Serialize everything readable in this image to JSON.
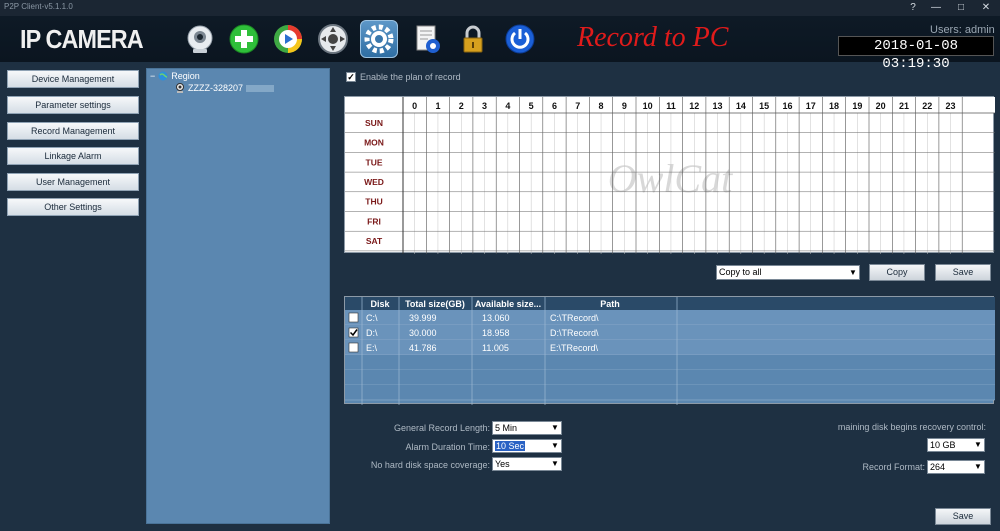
{
  "window": {
    "title": "P2P Client-v5.1.1.0",
    "help": "?",
    "minimize": "—",
    "maximize": "□",
    "close": "✕"
  },
  "header": {
    "app_title": "IP CAMERA",
    "toolbar": [
      {
        "name": "camera-icon"
      },
      {
        "name": "add-icon"
      },
      {
        "name": "playback-icon"
      },
      {
        "name": "ptz-icon"
      },
      {
        "name": "settings-icon",
        "active": true
      },
      {
        "name": "log-icon"
      },
      {
        "name": "lock-icon"
      },
      {
        "name": "power-icon"
      }
    ],
    "banner": "Record to PC",
    "users": "Users: admin",
    "datetime": "2018-01-08  03:19:30"
  },
  "sidebar": {
    "items": [
      {
        "label": "Device Management"
      },
      {
        "label": "Parameter settings"
      },
      {
        "label": "Record Management"
      },
      {
        "label": "Linkage Alarm"
      },
      {
        "label": "User Management"
      },
      {
        "label": "Other Settings"
      }
    ]
  },
  "tree": {
    "root": "Region",
    "collapse": "−",
    "device": "ZZZZ-328207"
  },
  "schedule": {
    "enable_label": "Enable the plan of record",
    "enabled": true,
    "hours": [
      "0",
      "1",
      "2",
      "3",
      "4",
      "5",
      "6",
      "7",
      "8",
      "9",
      "10",
      "11",
      "12",
      "13",
      "14",
      "15",
      "16",
      "17",
      "18",
      "19",
      "20",
      "21",
      "22",
      "23"
    ],
    "days": [
      "SUN",
      "MON",
      "TUE",
      "WED",
      "THU",
      "FRI",
      "SAT"
    ],
    "watermark": "OwlCat"
  },
  "copy": {
    "select_value": "Copy to all",
    "copy_label": "Copy",
    "save_label": "Save"
  },
  "disks": {
    "headers": [
      "Disk",
      "Total size(GB)",
      "Available size...",
      "Path"
    ],
    "rows": [
      {
        "checked": false,
        "disk": "C:\\",
        "total": "39.999",
        "available": "13.060",
        "path": "C:\\TRecord\\"
      },
      {
        "checked": true,
        "disk": "D:\\",
        "total": "30.000",
        "available": "18.958",
        "path": "D:\\TRecord\\"
      },
      {
        "checked": false,
        "disk": "E:\\",
        "total": "41.786",
        "available": "11.005",
        "path": "E:\\TRecord\\"
      }
    ]
  },
  "options": {
    "general_label": "General Record Length:",
    "general_value": "5 Min",
    "alarm_label": "Alarm Duration Time:",
    "alarm_value": "10 Sec",
    "nospace_label": "No hard disk space coverage:",
    "nospace_value": "Yes",
    "recovery_label": "maining disk begins recovery control:",
    "recovery_value": "10 GB",
    "format_label": "Record Format:",
    "format_value": "264",
    "save_label": "Save"
  }
}
